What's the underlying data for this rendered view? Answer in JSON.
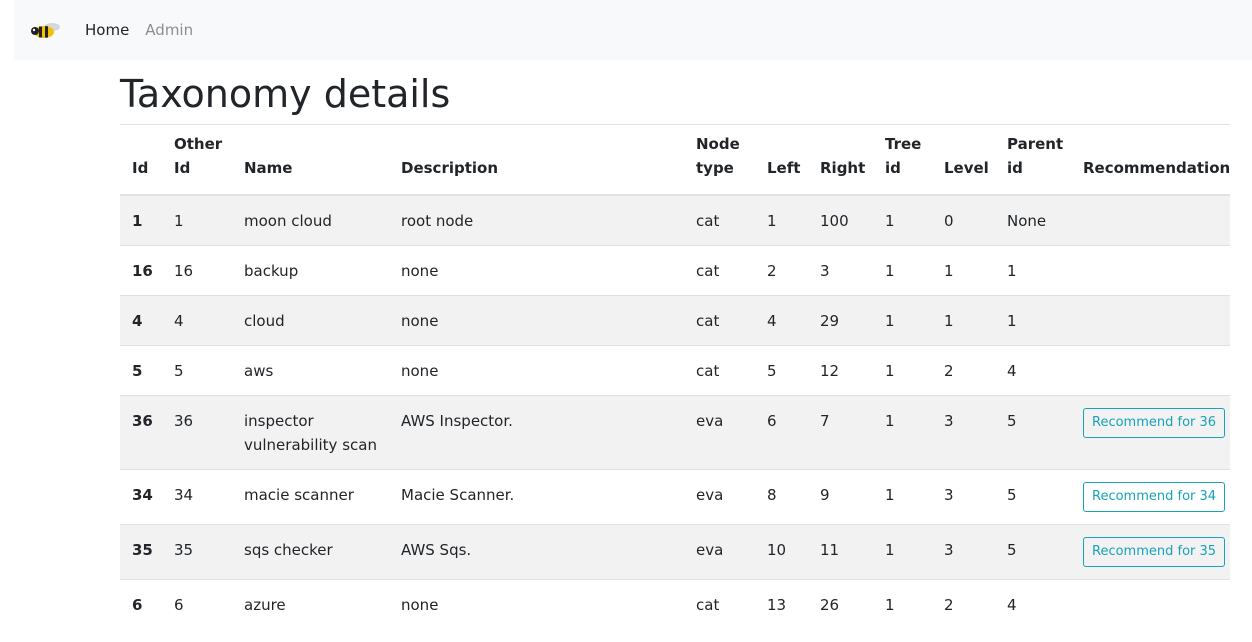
{
  "nav": {
    "home_label": "Home",
    "admin_label": "Admin"
  },
  "page": {
    "title": "Taxonomy details"
  },
  "table": {
    "headers": {
      "id": "Id",
      "other_id_1": "Other",
      "other_id_2": "Id",
      "name": "Name",
      "description": "Description",
      "node_type_1": "Node",
      "node_type_2": "type",
      "left": "Left",
      "right": "Right",
      "tree_id_1": "Tree",
      "tree_id_2": "id",
      "level": "Level",
      "parent_id_1": "Parent",
      "parent_id_2": "id",
      "recommendation": "Recommendation"
    },
    "rows": [
      {
        "id": "1",
        "other_id": "1",
        "name": "moon cloud",
        "description": "root node",
        "node_type": "cat",
        "left": "1",
        "right": "100",
        "tree_id": "1",
        "level": "0",
        "parent_id": "None",
        "recommend": null
      },
      {
        "id": "16",
        "other_id": "16",
        "name": "backup",
        "description": "none",
        "node_type": "cat",
        "left": "2",
        "right": "3",
        "tree_id": "1",
        "level": "1",
        "parent_id": "1",
        "recommend": null
      },
      {
        "id": "4",
        "other_id": "4",
        "name": "cloud",
        "description": "none",
        "node_type": "cat",
        "left": "4",
        "right": "29",
        "tree_id": "1",
        "level": "1",
        "parent_id": "1",
        "recommend": null
      },
      {
        "id": "5",
        "other_id": "5",
        "name": "aws",
        "description": "none",
        "node_type": "cat",
        "left": "5",
        "right": "12",
        "tree_id": "1",
        "level": "2",
        "parent_id": "4",
        "recommend": null
      },
      {
        "id": "36",
        "other_id": "36",
        "name": "inspector vulnerability scan",
        "description": "AWS Inspector.",
        "node_type": "eva",
        "left": "6",
        "right": "7",
        "tree_id": "1",
        "level": "3",
        "parent_id": "5",
        "recommend": "Recommend for 36"
      },
      {
        "id": "34",
        "other_id": "34",
        "name": "macie scanner",
        "description": "Macie Scanner.",
        "node_type": "eva",
        "left": "8",
        "right": "9",
        "tree_id": "1",
        "level": "3",
        "parent_id": "5",
        "recommend": "Recommend for 34"
      },
      {
        "id": "35",
        "other_id": "35",
        "name": "sqs checker",
        "description": "AWS Sqs.",
        "node_type": "eva",
        "left": "10",
        "right": "11",
        "tree_id": "1",
        "level": "3",
        "parent_id": "5",
        "recommend": "Recommend for 35"
      },
      {
        "id": "6",
        "other_id": "6",
        "name": "azure",
        "description": "none",
        "node_type": "cat",
        "left": "13",
        "right": "26",
        "tree_id": "1",
        "level": "2",
        "parent_id": "4",
        "recommend": null
      }
    ]
  }
}
